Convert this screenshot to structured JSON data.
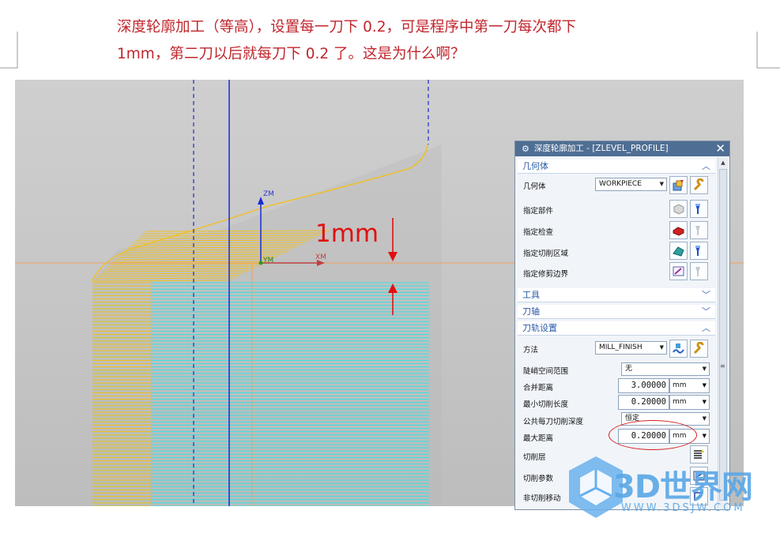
{
  "question": {
    "line1": "深度轮廓加工（等高），设置每一刀下 0.2，可是程序中第一刀每次都下",
    "line2": "1mm，第二刀以后就每刀下 0.2 了。这是为什么啊？"
  },
  "viewport": {
    "axis_zm": "ZM",
    "axis_xm": "XM",
    "axis_ym": "YM",
    "annotation": "1mm",
    "colors": {
      "background": "#c8c8c8",
      "toolpath_yellow": "#f0c020",
      "toolpath_cyan": "#40e0e0",
      "tool_axis_blue": "#1a2ad0",
      "annotation_red": "#e01010",
      "level_orange": "#f0a060"
    }
  },
  "dialog": {
    "title": "深度轮廓加工 - [ZLEVEL_PROFILE]",
    "sections": {
      "geometry": "几何体",
      "tool": "工具",
      "tool_axis": "刀轴",
      "path_settings": "刀轨设置"
    },
    "geometry": {
      "label": "几何体",
      "value": "WORKPIECE",
      "specify_part": "指定部件",
      "specify_check": "指定检查",
      "specify_cut_area": "指定切削区域",
      "specify_trim": "指定修剪边界"
    },
    "path": {
      "method_label": "方法",
      "method_value": "MILL_FINISH",
      "steep_label": "陡峭空间范围",
      "steep_value": "无",
      "merge_label": "合并距离",
      "merge_value": "3.00000",
      "merge_unit": "mm",
      "min_cut_label": "最小切削长度",
      "min_cut_value": "0.20000",
      "min_cut_unit": "mm",
      "common_depth_label": "公共每刀切削深度",
      "common_depth_value": "恒定",
      "max_dist_label": "最大距离",
      "max_dist_value": "0.20000",
      "max_dist_unit": "mm",
      "cut_levels_label": "切削层",
      "cut_params_label": "切削参数",
      "non_cut_label": "非切削移动"
    }
  },
  "watermark": {
    "brand": "3D世界网",
    "url": "WWW.3DSJW.COM"
  }
}
